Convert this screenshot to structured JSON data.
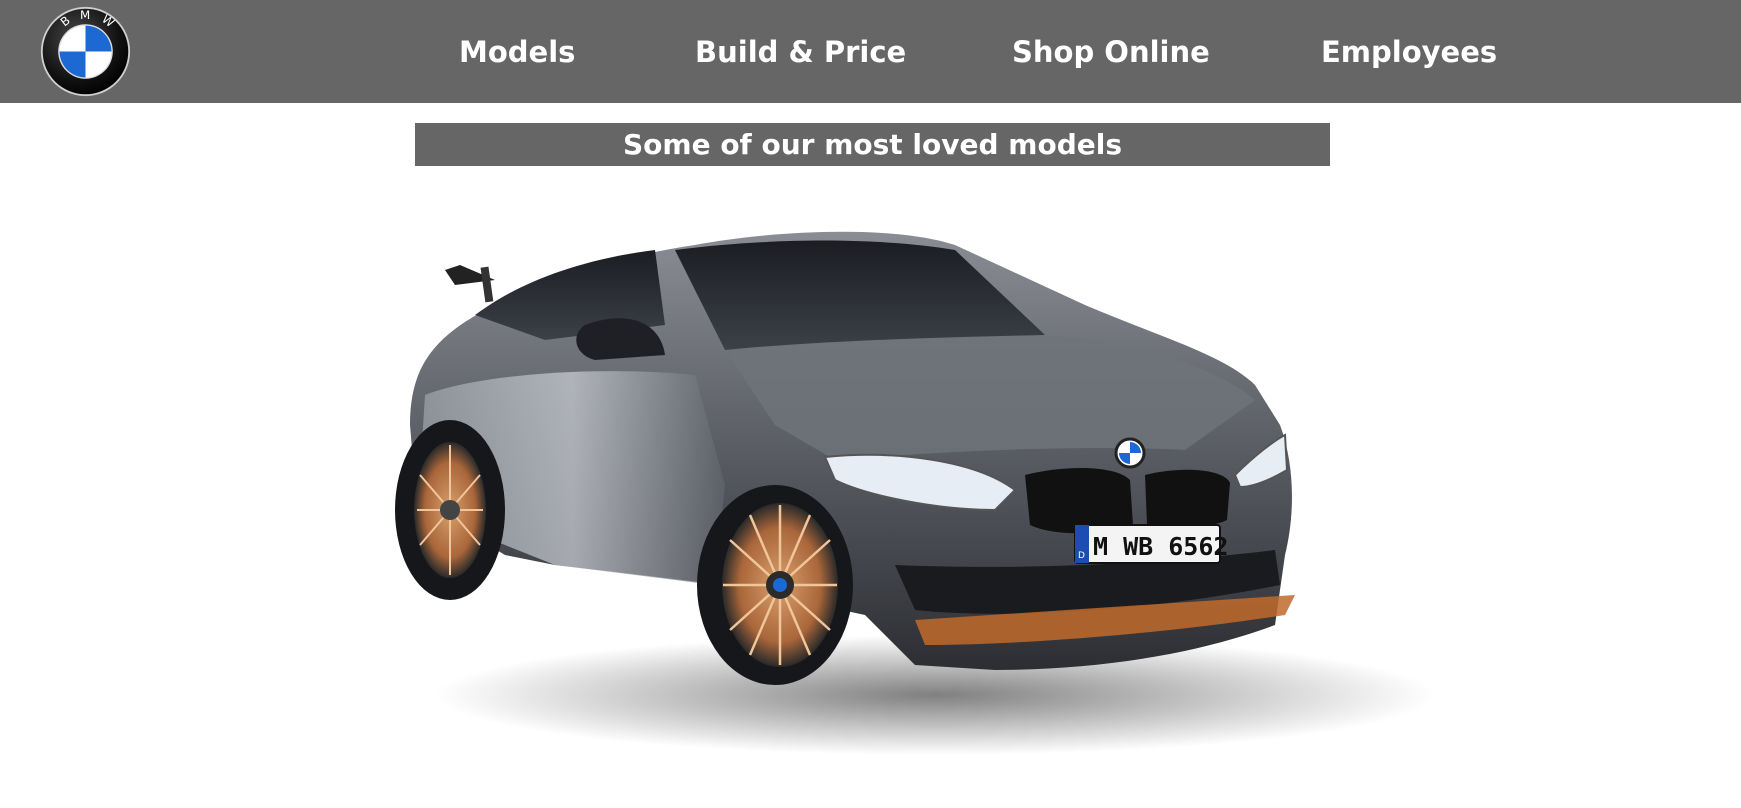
{
  "header": {
    "logo": {
      "icon": "bmw-roundel-icon",
      "letters": [
        "B",
        "M",
        "W"
      ]
    },
    "nav": [
      {
        "label": "Models"
      },
      {
        "label": "Build & Price"
      },
      {
        "label": "Shop Online"
      },
      {
        "label": "Employees"
      }
    ],
    "background_color": "#666667"
  },
  "main": {
    "section_title": "Some of our most loved models",
    "hero_image": {
      "subject": "gray-bmw-m4-coupe",
      "plate_text": "M WB 6562",
      "plate_country": "D"
    }
  },
  "colors": {
    "bmw_blue": "#1c69d4",
    "banner": "#666667",
    "text": "#ffffff"
  }
}
